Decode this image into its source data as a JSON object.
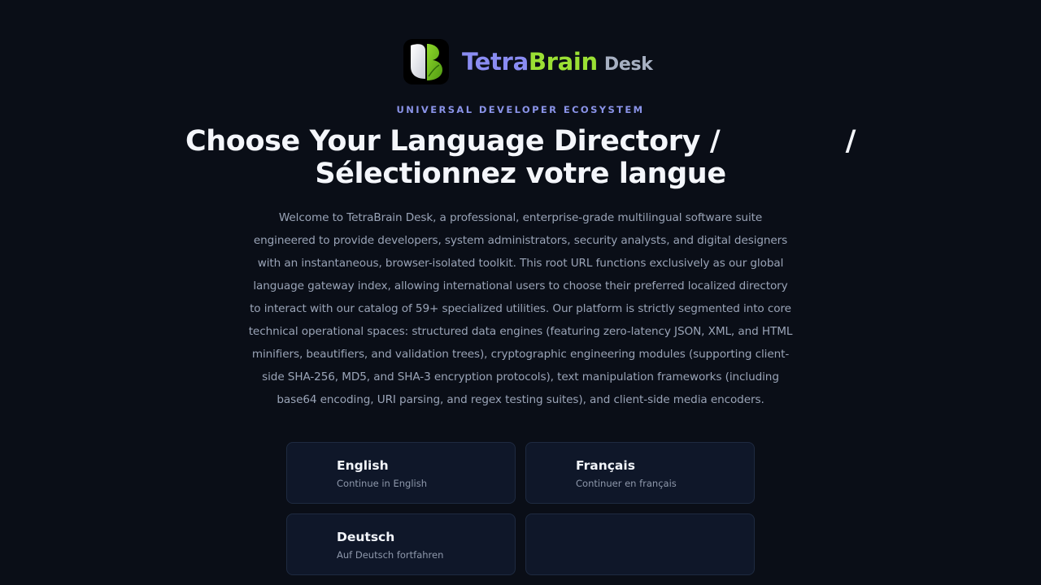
{
  "brand": {
    "logo_icon": "tetrabrain-leaf-icon",
    "name_part1": "Tetra",
    "name_part2": "Brain",
    "name_part3": "Desk",
    "colors": {
      "tetra": "#8a8cf2",
      "brain": "#9be034",
      "desk": "#a7b0c2"
    }
  },
  "eyebrow": "UNIVERSAL DEVELOPER ECOSYSTEM",
  "heading": {
    "line1_left": "Choose Your Language Directory /",
    "line1_right": "/",
    "line2": "Sélectionnez votre langue"
  },
  "intro": "Welcome to TetraBrain Desk, a professional, enterprise-grade multilingual software suite engineered to provide developers, system administrators, security analysts, and digital designers with an instantaneous, browser-isolated toolkit. This root URL functions exclusively as our global language gateway index, allowing international users to choose their preferred localized directory to interact with our catalog of 59+ specialized utilities. Our platform is strictly segmented into core technical operational spaces: structured data engines (featuring zero-latency JSON, XML, and HTML minifiers, beautifiers, and validation trees), cryptographic engineering modules (supporting client-side SHA-256, MD5, and SHA-3 encryption protocols), text manipulation frameworks (including base64 encoding, URI parsing, and regex testing suites), and client-side media encoders.",
  "languages": [
    {
      "name": "English",
      "subtitle": "Continue in English"
    },
    {
      "name": "Français",
      "subtitle": "Continuer en français"
    },
    {
      "name": "Deutsch",
      "subtitle": "Auf Deutsch fortfahren"
    },
    {
      "name": "",
      "subtitle": ""
    }
  ],
  "theme": {
    "background": "#0a0e17",
    "card_background": "#0f1729",
    "card_border": "#1e2a40",
    "accent": "#8a93e8"
  }
}
